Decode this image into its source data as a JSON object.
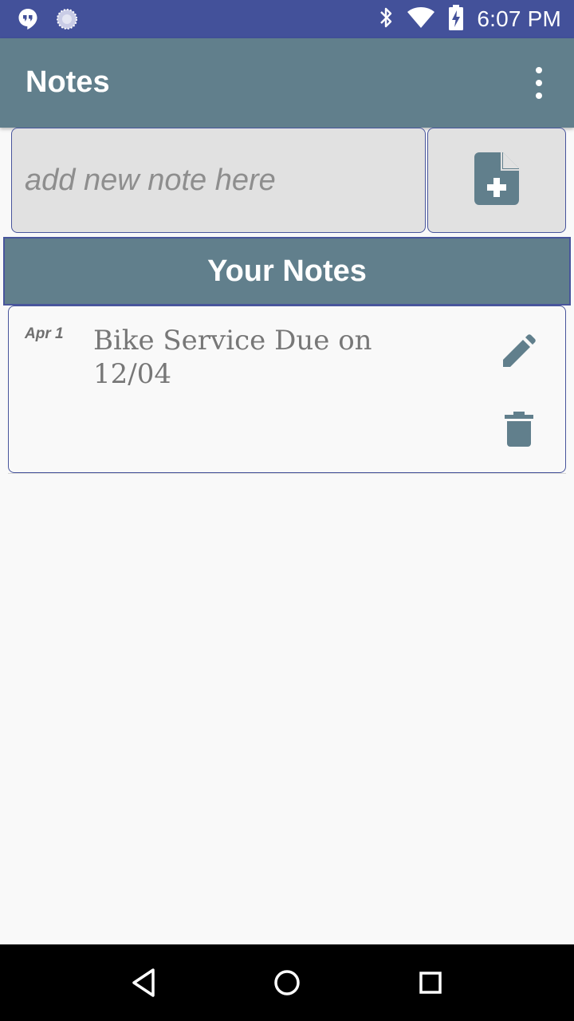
{
  "status_bar": {
    "time": "6:07 PM",
    "left_icons": [
      "hangouts-icon",
      "loading-icon"
    ],
    "right_icons": [
      "bluetooth-icon",
      "wifi-icon",
      "battery-charging-icon"
    ]
  },
  "app_bar": {
    "title": "Notes",
    "menu_icon": "more-vert-icon"
  },
  "input": {
    "placeholder": "add new note here",
    "value": "",
    "add_icon": "note-add-icon"
  },
  "section": {
    "title": "Your Notes"
  },
  "notes": [
    {
      "date": "Apr 1",
      "text": "Bike Service Due on 12/04",
      "edit_icon": "pencil-icon",
      "delete_icon": "trash-icon"
    }
  ],
  "nav_bar": {
    "icons": [
      "back-icon",
      "home-icon",
      "recents-icon"
    ]
  },
  "colors": {
    "status_bar": "#43519a",
    "app_bar": "#617f8c",
    "accent_border": "#48559c",
    "icon_gray": "#617f8c",
    "input_bg": "#e1e1e1"
  }
}
